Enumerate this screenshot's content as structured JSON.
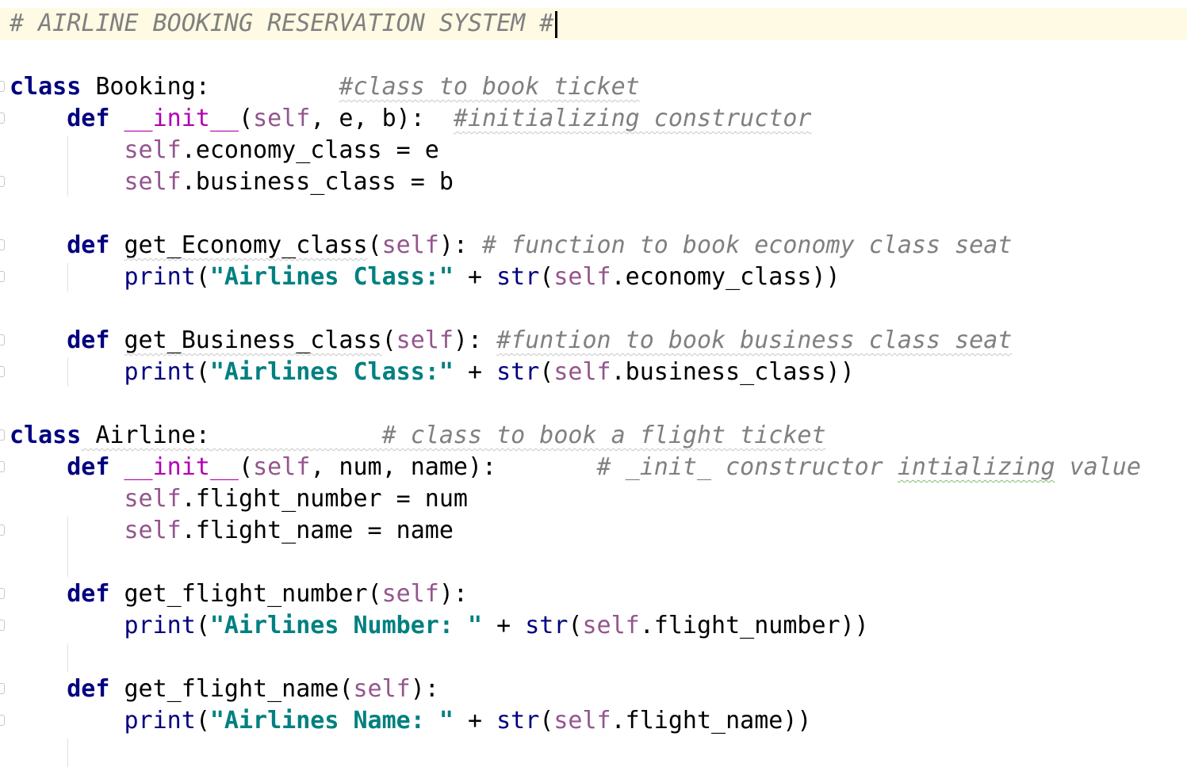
{
  "editor": {
    "lines": [
      {
        "tokens": [
          {
            "t": "cm",
            "v": "# AIRLINE BOOKING RESERVATION SYSTEM #"
          }
        ],
        "current": true
      },
      {
        "tokens": []
      },
      {
        "tokens": [
          {
            "t": "kw",
            "v": "class"
          },
          {
            "t": "plain",
            "v": " Booking:         "
          },
          {
            "t": "cm",
            "v": "#class to book ticket",
            "sq": true
          }
        ],
        "fold": true
      },
      {
        "tokens": [
          {
            "t": "plain",
            "v": "    "
          },
          {
            "t": "kw",
            "v": "def"
          },
          {
            "t": "plain",
            "v": " "
          },
          {
            "t": "dunder",
            "v": "__init__"
          },
          {
            "t": "plain",
            "v": "("
          },
          {
            "t": "self",
            "v": "self"
          },
          {
            "t": "plain",
            "v": ", e, b):  "
          },
          {
            "t": "cm",
            "v": "#initializing constructor",
            "sq": true
          }
        ],
        "fold": true
      },
      {
        "tokens": [
          {
            "t": "plain",
            "v": "        "
          },
          {
            "t": "self",
            "v": "self"
          },
          {
            "t": "plain",
            "v": ".economy_class = e"
          }
        ]
      },
      {
        "tokens": [
          {
            "t": "plain",
            "v": "        "
          },
          {
            "t": "self",
            "v": "self"
          },
          {
            "t": "plain",
            "v": ".business_class = b"
          }
        ],
        "fold": true
      },
      {
        "tokens": []
      },
      {
        "tokens": [
          {
            "t": "plain",
            "v": "    "
          },
          {
            "t": "kw",
            "v": "def"
          },
          {
            "t": "plain",
            "v": " "
          },
          {
            "t": "fn",
            "v": "get_Economy_class",
            "sq": true
          },
          {
            "t": "plain",
            "v": "("
          },
          {
            "t": "self",
            "v": "self"
          },
          {
            "t": "plain",
            "v": "): "
          },
          {
            "t": "cm",
            "v": "# function to book economy class seat"
          }
        ],
        "fold": true
      },
      {
        "tokens": [
          {
            "t": "plain",
            "v": "        "
          },
          {
            "t": "bi",
            "v": "print"
          },
          {
            "t": "plain",
            "v": "("
          },
          {
            "t": "str",
            "v": "\"Airlines Class:\""
          },
          {
            "t": "plain",
            "v": " + "
          },
          {
            "t": "bi",
            "v": "str"
          },
          {
            "t": "plain",
            "v": "("
          },
          {
            "t": "self",
            "v": "self"
          },
          {
            "t": "plain",
            "v": ".economy_class))"
          }
        ],
        "fold": true
      },
      {
        "tokens": []
      },
      {
        "tokens": [
          {
            "t": "plain",
            "v": "    "
          },
          {
            "t": "kw",
            "v": "def"
          },
          {
            "t": "plain",
            "v": " "
          },
          {
            "t": "fn",
            "v": "get_Business_class",
            "sq": true
          },
          {
            "t": "plain",
            "v": "("
          },
          {
            "t": "self",
            "v": "self"
          },
          {
            "t": "plain",
            "v": "): "
          },
          {
            "t": "cm",
            "v": "#funtion to book business class seat",
            "sq": true
          }
        ],
        "fold": true
      },
      {
        "tokens": [
          {
            "t": "plain",
            "v": "        "
          },
          {
            "t": "bi",
            "v": "print"
          },
          {
            "t": "plain",
            "v": "("
          },
          {
            "t": "str",
            "v": "\"Airlines Class:\""
          },
          {
            "t": "plain",
            "v": " + "
          },
          {
            "t": "bi",
            "v": "str"
          },
          {
            "t": "plain",
            "v": "("
          },
          {
            "t": "self",
            "v": "self"
          },
          {
            "t": "plain",
            "v": ".business_class))"
          }
        ],
        "fold": true
      },
      {
        "tokens": []
      },
      {
        "tokens": [
          {
            "t": "kw",
            "v": "class"
          },
          {
            "t": "plain",
            "v": " Airline:",
            "sq": true
          },
          {
            "t": "plain",
            "v": "            ",
            "sq": true
          },
          {
            "t": "cm",
            "v": "# class to book a flight ticket",
            "sq": true
          }
        ],
        "fold": true
      },
      {
        "tokens": [
          {
            "t": "plain",
            "v": "    "
          },
          {
            "t": "kw",
            "v": "def"
          },
          {
            "t": "plain",
            "v": " "
          },
          {
            "t": "dunder",
            "v": "__init__"
          },
          {
            "t": "plain",
            "v": "("
          },
          {
            "t": "self",
            "v": "self"
          },
          {
            "t": "plain",
            "v": ", num, name):       "
          },
          {
            "t": "cm",
            "v": "# _init_ constructor "
          },
          {
            "t": "cm",
            "v": "intializing",
            "sqg": true
          },
          {
            "t": "cm",
            "v": " value"
          }
        ],
        "fold": true
      },
      {
        "tokens": [
          {
            "t": "plain",
            "v": "        "
          },
          {
            "t": "self",
            "v": "self"
          },
          {
            "t": "plain",
            "v": ".flight_number = num"
          }
        ]
      },
      {
        "tokens": [
          {
            "t": "plain",
            "v": "        "
          },
          {
            "t": "self",
            "v": "self"
          },
          {
            "t": "plain",
            "v": ".flight_name = name"
          }
        ],
        "fold": true
      },
      {
        "tokens": []
      },
      {
        "tokens": [
          {
            "t": "plain",
            "v": "    "
          },
          {
            "t": "kw",
            "v": "def"
          },
          {
            "t": "plain",
            "v": " "
          },
          {
            "t": "fn",
            "v": "get_flight_number"
          },
          {
            "t": "plain",
            "v": "("
          },
          {
            "t": "self",
            "v": "self"
          },
          {
            "t": "plain",
            "v": "):"
          }
        ],
        "fold": true
      },
      {
        "tokens": [
          {
            "t": "plain",
            "v": "        "
          },
          {
            "t": "bi",
            "v": "print"
          },
          {
            "t": "plain",
            "v": "("
          },
          {
            "t": "str",
            "v": "\"Airlines Number: \""
          },
          {
            "t": "plain",
            "v": " + "
          },
          {
            "t": "bi",
            "v": "str"
          },
          {
            "t": "plain",
            "v": "("
          },
          {
            "t": "self",
            "v": "self"
          },
          {
            "t": "plain",
            "v": ".flight_number))"
          }
        ],
        "fold": true
      },
      {
        "tokens": []
      },
      {
        "tokens": [
          {
            "t": "plain",
            "v": "    "
          },
          {
            "t": "kw",
            "v": "def"
          },
          {
            "t": "plain",
            "v": " "
          },
          {
            "t": "fn",
            "v": "get_flight_name"
          },
          {
            "t": "plain",
            "v": "("
          },
          {
            "t": "self",
            "v": "self"
          },
          {
            "t": "plain",
            "v": "):"
          }
        ],
        "fold": true
      },
      {
        "tokens": [
          {
            "t": "plain",
            "v": "        "
          },
          {
            "t": "bi",
            "v": "print"
          },
          {
            "t": "plain",
            "v": "("
          },
          {
            "t": "str",
            "v": "\"Airlines Name: \""
          },
          {
            "t": "plain",
            "v": " + "
          },
          {
            "t": "bi",
            "v": "str"
          },
          {
            "t": "plain",
            "v": "("
          },
          {
            "t": "self",
            "v": "self"
          },
          {
            "t": "plain",
            "v": ".flight_name))"
          }
        ],
        "fold": true
      }
    ]
  }
}
